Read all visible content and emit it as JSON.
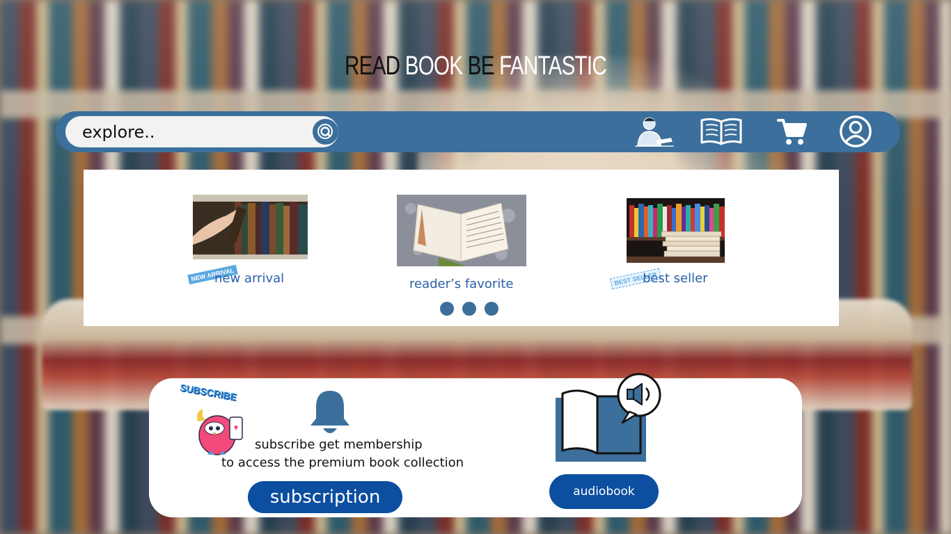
{
  "headline": {
    "word1": "READ ",
    "word2": "BOOK",
    "word3": " BE ",
    "word4": "FANTASTIC"
  },
  "search": {
    "placeholder": "explore.."
  },
  "nav_icons": [
    "reader-icon",
    "open-book-icon",
    "cart-icon",
    "user-account-icon"
  ],
  "categories": [
    {
      "label": "new arrival",
      "badge": "NEW ARRIVAL",
      "image": "hand-picking-book-from-shelf"
    },
    {
      "label": "reader’s favorite",
      "image": "open-book-on-carpet"
    },
    {
      "label": "best seller",
      "badge": "BEST SELLER",
      "image": "colorful-books-on-shelf"
    }
  ],
  "carousel": {
    "dots": 3
  },
  "promo": {
    "subscribe_sticker": "SUBSCRIBE",
    "line1": "subscribe  get membership",
    "line2": "to access the premium book collection",
    "subscription_button": "subscription",
    "audiobook_button": "audiobook"
  },
  "colors": {
    "nav_blue": "#3c6f9b",
    "button_blue": "#0c4ea0",
    "link_blue": "#2a5fa8"
  }
}
